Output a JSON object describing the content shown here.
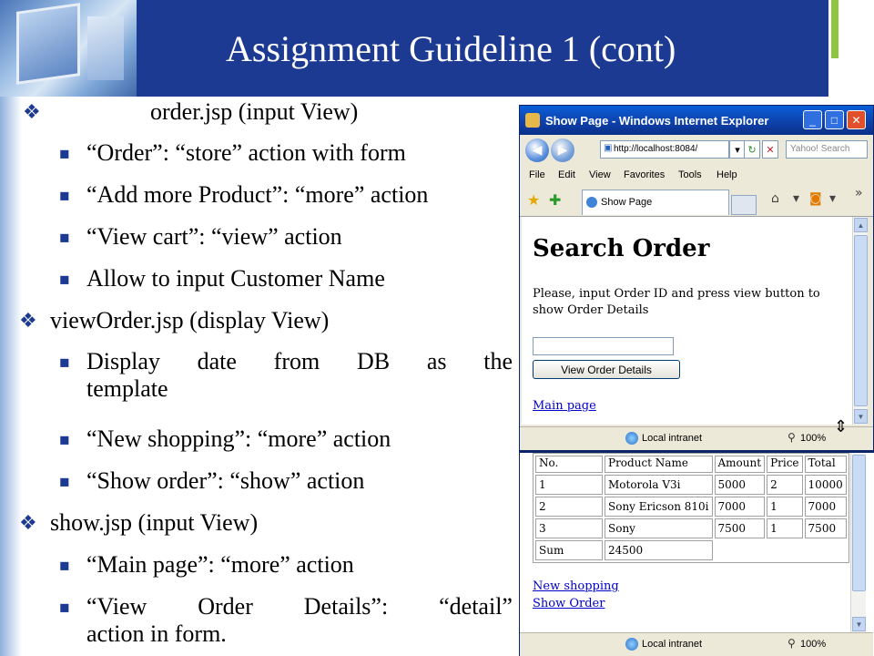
{
  "slide": {
    "title": "Assignment Guideline 1 (cont)",
    "bullets": [
      {
        "level": 1,
        "text": "order.jsp (input View)"
      },
      {
        "level": 2,
        "text": "“Order”: “store” action with form"
      },
      {
        "level": 2,
        "text": "“Add more Product”: “more” action"
      },
      {
        "level": 2,
        "text": "“View cart”: “view” action"
      },
      {
        "level": 2,
        "text": "Allow to input Customer Name"
      },
      {
        "level": 1,
        "text": "viewOrder.jsp (display View)"
      },
      {
        "level": 2,
        "text": "Display date from DB as the template"
      },
      {
        "level": 2,
        "text": "“New shopping”: “more” action"
      },
      {
        "level": 2,
        "text": "“Show order”: “show” action"
      },
      {
        "level": 1,
        "text": "show.jsp (input View)"
      },
      {
        "level": 2,
        "text": "“Main page”: “more” action"
      },
      {
        "level": 2,
        "text": "“View Order Details”: “detail” action in form."
      }
    ],
    "wrapped": {
      "b7_line1": [
        "Display",
        "date",
        "from",
        "DB",
        "as",
        "the"
      ],
      "b7_line2": "template",
      "b12_line1": [
        "“View",
        "Order",
        "Details”:",
        "“detail”"
      ],
      "b12_line2": "action in form."
    }
  },
  "browser": {
    "window_title": "Show Page - Windows Internet Explorer",
    "address": "http://localhost:8084/",
    "search_placeholder": "Yahoo! Search",
    "menu": [
      "File",
      "Edit",
      "View",
      "Favorites",
      "Tools",
      "Help"
    ],
    "tab_label": "Show Page",
    "page": {
      "heading": "Search Order",
      "instructions": "Please, input Order ID and press view button to show Order Details",
      "order_id_value": "",
      "button_label": "View Order Details",
      "link_main": "Main page"
    },
    "status": {
      "zone": "Local intranet",
      "zoom": "100%"
    }
  },
  "browser2": {
    "table": {
      "headers": [
        "No.",
        "Product Name",
        "Amount",
        "Price",
        "Total"
      ],
      "rows": [
        [
          "1",
          "Motorola V3i",
          "5000",
          "2",
          "10000"
        ],
        [
          "2",
          "Sony Ericson 810i",
          "7000",
          "1",
          "7000"
        ],
        [
          "3",
          "Sony",
          "7500",
          "1",
          "7500"
        ]
      ],
      "sum_label": "Sum",
      "sum_value": "24500"
    },
    "links": [
      "New shopping",
      "Show Order"
    ],
    "status": {
      "zone": "Local intranet",
      "zoom": "100%"
    }
  },
  "colors": {
    "header_blue": "#1d3a93",
    "accent_green": "#8dc63f",
    "link": "#0000cc"
  }
}
